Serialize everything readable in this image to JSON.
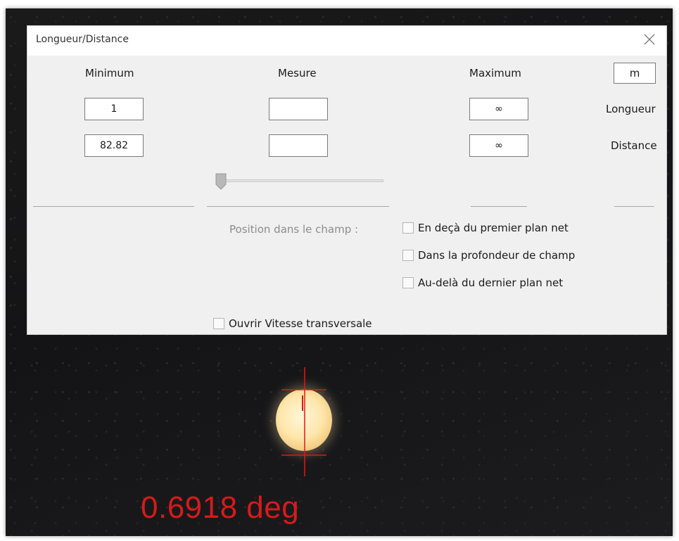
{
  "dialog": {
    "title": "Longueur/Distance"
  },
  "headers": {
    "minimum": "Minimum",
    "mesure": "Mesure",
    "maximum": "Maximum",
    "unit": "m"
  },
  "rows": {
    "longueur": {
      "label": "Longueur",
      "min": "1",
      "mesure": "",
      "max": "∞"
    },
    "distance": {
      "label": "Distance",
      "min": "82.82",
      "mesure": "",
      "max": "∞"
    }
  },
  "slider": {
    "value": 0.0
  },
  "position": {
    "label": "Position dans le champ :",
    "options": [
      {
        "label": "En deçà du premier plan net",
        "checked": false
      },
      {
        "label": "Dans la profondeur de champ",
        "checked": false
      },
      {
        "label": "Au-delà du dernier plan net",
        "checked": false
      }
    ]
  },
  "ouvrir_vitesse": {
    "label": "Ouvrir Vitesse transversale",
    "checked": false
  },
  "overlay": {
    "readout": "0.6918 deg",
    "color": "#d71a1a"
  },
  "icons": {
    "close": "close-icon",
    "slider_thumb": "slider-thumb-icon"
  }
}
